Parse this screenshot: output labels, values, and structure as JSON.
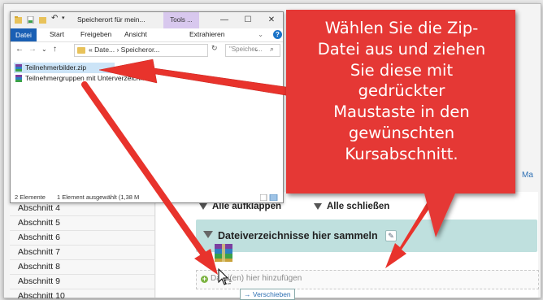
{
  "explorer": {
    "title": "Speicherort für mein...",
    "tools_tab": "Tools ...",
    "ribbon_tabs": [
      "Datei",
      "Start",
      "Freigeben",
      "Ansicht",
      "Extrahieren"
    ],
    "address_path": "« Date... › Speicheror...",
    "search_placeholder": "\"Speicher...",
    "files": [
      {
        "name": "Teilnehmerbilder.zip",
        "selected": true
      },
      {
        "name": "Teilnehmergruppen mit Unterverzeichn"
      }
    ],
    "status_count": "2 Elemente",
    "status_selected": "1 Element ausgewählt (1,38 M",
    "icons": [
      "back-icon",
      "forward-icon",
      "up-icon",
      "folder-icon",
      "refresh-icon",
      "search-icon",
      "help-icon",
      "minimize-icon",
      "maximize-icon",
      "close-icon",
      "zip-file-icon"
    ]
  },
  "callout": {
    "lines": [
      "Wählen Sie die Zip-",
      "Datei aus und ziehen",
      "Sie diese mit",
      "gedrückter",
      "Maustaste in den",
      "gewünschten",
      "Kursabschnitt."
    ],
    "color": "#e53935"
  },
  "lms": {
    "sidebar_items": [
      "Abschnitt 4",
      "Abschnitt 5",
      "Abschnitt 6",
      "Abschnitt 7",
      "Abschnitt 8",
      "Abschnitt 9",
      "Abschnitt 10"
    ],
    "expand_all": "Alle aufklappen",
    "collapse_all": "Alle schließen",
    "section_title": "Dateiverzeichnisse hier sammeln",
    "add_placeholder": "Datei(en) hier hinzufügen",
    "drag_tooltip": "Verschieben",
    "right_link": "Ma",
    "section_color": "#bfe0de"
  }
}
